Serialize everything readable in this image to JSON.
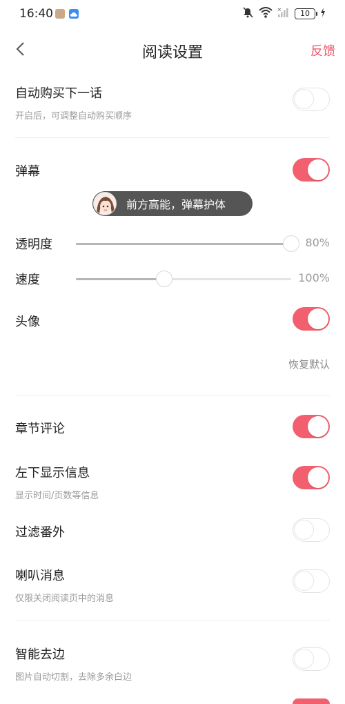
{
  "status_bar": {
    "time": "16:40",
    "battery": "10"
  },
  "nav": {
    "title": "阅读设置",
    "feedback": "反馈"
  },
  "settings": {
    "auto_buy": {
      "label": "自动购买下一话",
      "sub": "开启后，可调整自动购买顺序",
      "enabled": false
    },
    "danmaku": {
      "label": "弹幕",
      "enabled": true
    },
    "danmaku_preview": {
      "text": "前方高能，弹幕护体"
    },
    "opacity": {
      "label": "透明度",
      "value_text": "80%",
      "level": 1.0
    },
    "speed": {
      "label": "速度",
      "value_text": "100%",
      "level": 0.41
    },
    "avatar": {
      "label": "头像",
      "enabled": true
    },
    "restore_default": "恢复默认",
    "chapter_comments": {
      "label": "章节评论",
      "enabled": true
    },
    "bottom_left_info": {
      "label": "左下显示信息",
      "sub": "显示时间/页数等信息",
      "enabled": true
    },
    "filter_extras": {
      "label": "过滤番外",
      "enabled": false
    },
    "horn_messages": {
      "label": "喇叭消息",
      "sub": "仅限关闭阅读页中的消息",
      "enabled": false
    },
    "smart_crop": {
      "label": "智能去边",
      "sub": "图片自动切割，去除多余白边",
      "enabled": false
    }
  },
  "colors": {
    "accent": "#f2606f",
    "feedback": "#f0546b"
  }
}
